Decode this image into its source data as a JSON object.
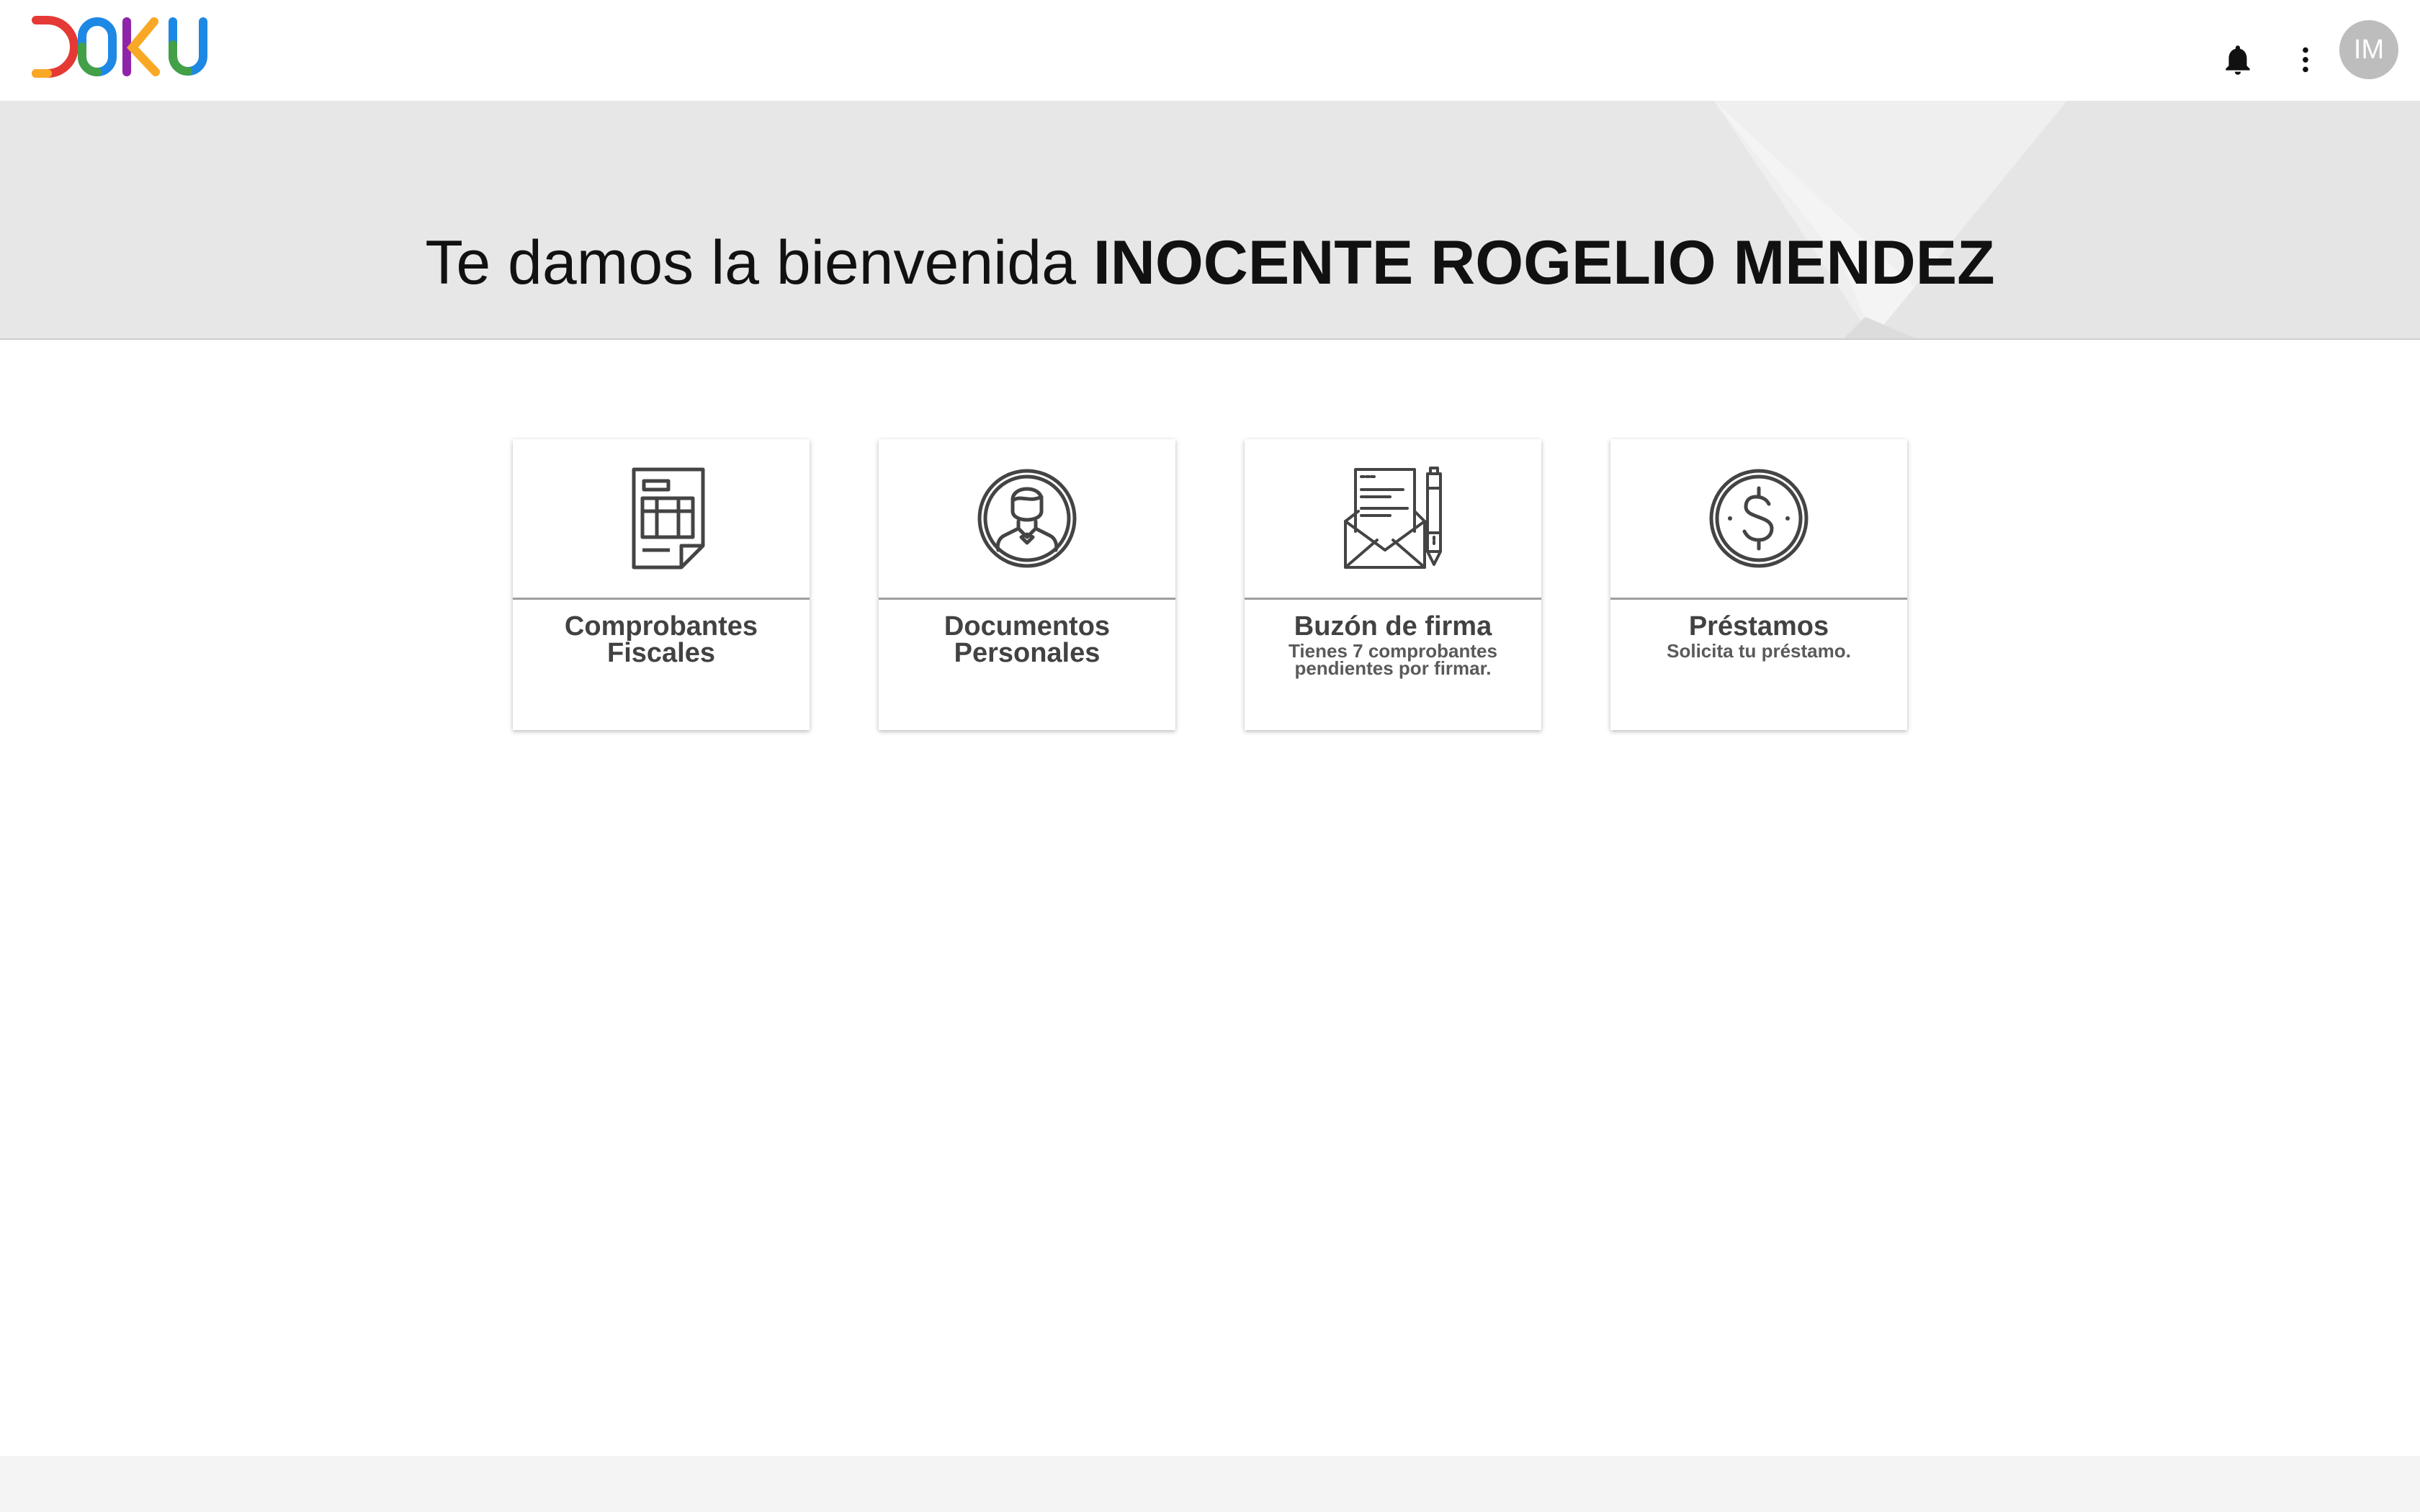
{
  "header": {
    "logo_alt": "DOKU",
    "notifications_icon": "bell-icon",
    "menu_icon": "more-vert-icon",
    "avatar_initials": "IM"
  },
  "hero": {
    "welcome_text": "Te damos la bienvenida",
    "user_name": "INOCENTE ROGELIO MENDEZ"
  },
  "cards": [
    {
      "title": "Comprobantes Fiscales",
      "subtitle": "",
      "icon": "invoice-icon"
    },
    {
      "title": "Documentos Personales",
      "subtitle": "",
      "icon": "person-icon"
    },
    {
      "title": "Buzón de firma",
      "subtitle": "Tienes 7 comprobantes pendientes por firmar.",
      "icon": "mail-sign-icon"
    },
    {
      "title": "Préstamos",
      "subtitle": "Solicita tu préstamo.",
      "icon": "dollar-coin-icon"
    }
  ],
  "colors": {
    "logo": [
      "#e53935",
      "#f9a825",
      "#43a047",
      "#1e88e5",
      "#8e24aa"
    ],
    "icon_stroke": "#444444",
    "hero_bg": "#e7e7e7"
  }
}
